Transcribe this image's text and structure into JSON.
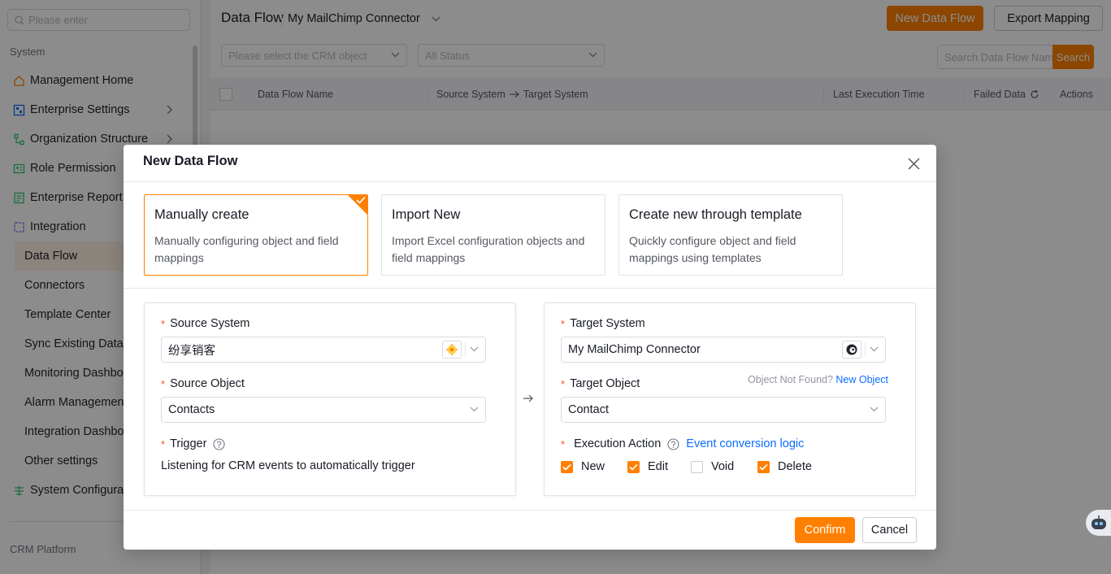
{
  "sidebar": {
    "search_placeholder": "Please enter",
    "group_system": "System",
    "items": [
      {
        "label": "Management Home"
      },
      {
        "label": "Enterprise Settings"
      },
      {
        "label": "Organization Structure"
      },
      {
        "label": "Role Permission"
      },
      {
        "label": "Enterprise Report"
      },
      {
        "label": "Integration"
      }
    ],
    "sub_items": [
      {
        "label": "Data Flow"
      },
      {
        "label": "Connectors"
      },
      {
        "label": "Template Center"
      },
      {
        "label": "Sync Existing Data"
      },
      {
        "label": "Monitoring Dashboard"
      },
      {
        "label": "Alarm Management"
      },
      {
        "label": "Integration Dashboard"
      },
      {
        "label": "Other settings"
      }
    ],
    "system_config": "System Configuration",
    "group_crm": "CRM Platform"
  },
  "header": {
    "title": "Data Flow",
    "connector": "My MailChimp Connector",
    "new_button": "New Data Flow",
    "export_button": "Export Mapping"
  },
  "filters": {
    "crm_object_placeholder": "Please select the CRM object",
    "status": "All Status",
    "search_placeholder": "Search Data Flow Name",
    "search_button": "Search"
  },
  "table": {
    "columns": {
      "name": "Data Flow Name",
      "source": "Source System",
      "target": "Target System",
      "last_exec": "Last Execution Time",
      "failed": "Failed Data",
      "actions": "Actions"
    }
  },
  "dialog": {
    "title": "New Data Flow",
    "modes": [
      {
        "title": "Manually create",
        "desc": "Manually configuring object and field mappings"
      },
      {
        "title": "Import New",
        "desc": "Import Excel configuration objects and field mappings"
      },
      {
        "title": "Create new through template",
        "desc": "Quickly configure object and field mappings using templates"
      }
    ],
    "source": {
      "system_label": "Source System",
      "system_value": "纷享销客",
      "object_label": "Source Object",
      "object_value": "Contacts",
      "trigger_label": "Trigger",
      "trigger_text": "Listening for CRM events to automatically trigger"
    },
    "target": {
      "system_label": "Target System",
      "system_value": "My MailChimp Connector",
      "object_label": "Target Object",
      "object_not_found": "Object Not Found?",
      "new_object": "New Object",
      "object_value": "Contact",
      "action_label": "Execution Action",
      "event_logic": "Event conversion logic",
      "actions": [
        {
          "label": "New",
          "checked": true
        },
        {
          "label": "Edit",
          "checked": true
        },
        {
          "label": "Void",
          "checked": false
        },
        {
          "label": "Delete",
          "checked": true
        }
      ]
    },
    "confirm": "Confirm",
    "cancel": "Cancel"
  },
  "colors": {
    "accent": "#ff8000",
    "link": "#0c6cff",
    "required": "#ff522a"
  }
}
